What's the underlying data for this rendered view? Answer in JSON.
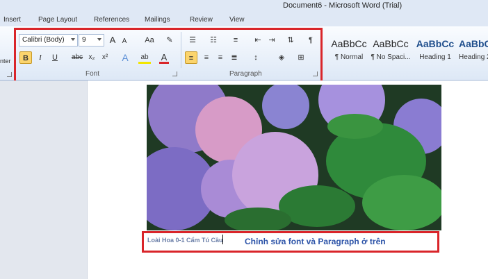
{
  "window": {
    "title": "Document6  -  Microsoft Word (Trial)"
  },
  "tabs": [
    {
      "label": "Insert"
    },
    {
      "label": "Page Layout"
    },
    {
      "label": "References"
    },
    {
      "label": "Mailings"
    },
    {
      "label": "Review"
    },
    {
      "label": "View"
    }
  ],
  "ribbon": {
    "edge_label": "nter",
    "font": {
      "name": "Calibri (Body)",
      "size": "9",
      "group_label": "Font",
      "grow_label": "A",
      "shrink_label": "A",
      "case_label": "Aa",
      "bold": "B",
      "italic": "I",
      "underline": "U",
      "strike": "abc",
      "subscript": "x₂",
      "superscript": "x²",
      "text_effects": "A",
      "highlight": "ab",
      "font_color": "A"
    },
    "paragraph": {
      "group_label": "Paragraph",
      "pilcrow": "¶"
    },
    "styles": [
      {
        "sample": "AaBbCc",
        "label": "¶ Normal"
      },
      {
        "sample": "AaBbCc",
        "label": "¶ No Spaci..."
      },
      {
        "sample": "AaBbCc",
        "label": "Heading 1"
      },
      {
        "sample": "AaBbC",
        "label": "Heading 2"
      }
    ]
  },
  "document": {
    "caption": "Loài Hoa 0-1 Cẩm Tú Cầu",
    "annotation": "Chỉnh sửa font và Paragraph ở trên"
  },
  "colors": {
    "highlight_border": "#d9252a",
    "annotation_text": "#2c53a8",
    "active_button": "#fbd46d"
  }
}
